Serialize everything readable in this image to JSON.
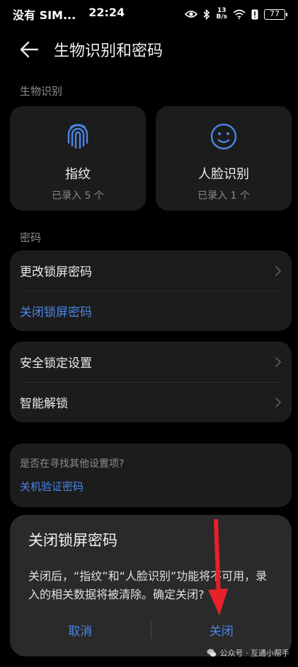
{
  "status_bar": {
    "carrier": "没有 SIM...",
    "time": "22:24",
    "net_speed_top": "13",
    "net_speed_bottom": "B/s",
    "battery": "77"
  },
  "header": {
    "title": "生物识别和密码"
  },
  "biometrics": {
    "section_label": "生物识别",
    "fingerprint": {
      "name": "指纹",
      "status": "已录入 5 个"
    },
    "face": {
      "name": "人脸识别",
      "status": "已录入 1 个"
    }
  },
  "password": {
    "section_label": "密码",
    "change_lock_password": "更改锁屏密码",
    "turn_off_lock_password": "关闭锁屏密码"
  },
  "security": {
    "lock_settings": "安全锁定设置",
    "smart_unlock": "智能解锁"
  },
  "hint": {
    "question": "是否在寻找其他设置项?",
    "link": "关机验证密码"
  },
  "dialog": {
    "title": "关闭锁屏密码",
    "message": "关闭后，“指纹”和“人脸识别”功能将不可用，录入的相关数据将被清除。确定关闭?",
    "cancel": "取消",
    "confirm": "关闭"
  },
  "watermark": {
    "text": "公众号 · 互通小帮手"
  },
  "colors": {
    "accent": "#4a86e8",
    "card": "#1c1c1c",
    "dialog": "#2a2a2a",
    "annotation": "#e8202a"
  }
}
